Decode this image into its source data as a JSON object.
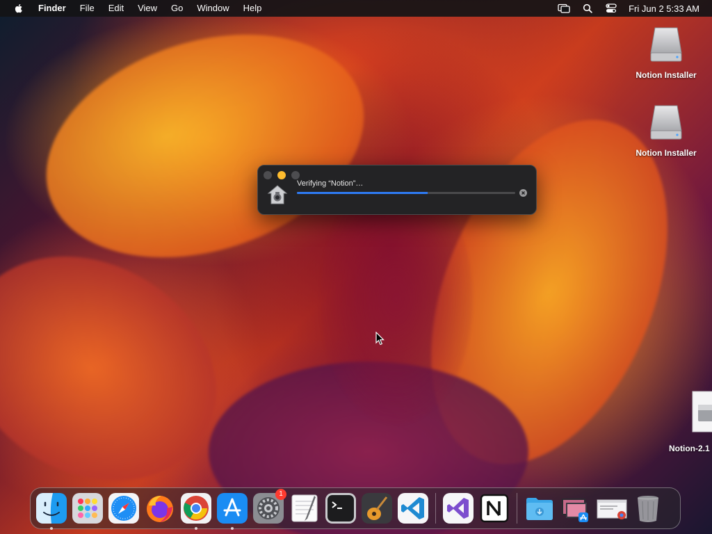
{
  "menubar": {
    "app_name": "Finder",
    "menus": [
      "File",
      "Edit",
      "View",
      "Go",
      "Window",
      "Help"
    ],
    "clock": "Fri Jun 2  5:33 AM",
    "status_icons": [
      "screen-mirroring-icon",
      "spotlight-search-icon",
      "control-center-icon"
    ]
  },
  "desktop": {
    "icons": [
      {
        "label": "Notion Installer",
        "icon": "external-drive-icon"
      },
      {
        "label": "Notion Installer",
        "icon": "external-drive-icon"
      },
      {
        "label": "Notion-2.1",
        "icon": "disk-image-file-icon"
      }
    ]
  },
  "dialog": {
    "title": "Verifying “Notion”…",
    "progress": 0.6,
    "app_icon": "finder-verification-icon",
    "progress_color": "#2e7cf6"
  },
  "dock": {
    "apps": [
      {
        "name": "Finder",
        "running": true
      },
      {
        "name": "Launchpad",
        "running": false
      },
      {
        "name": "Safari",
        "running": false
      },
      {
        "name": "Firefox",
        "running": false
      },
      {
        "name": "Google Chrome",
        "running": true
      },
      {
        "name": "App Store",
        "running": true
      },
      {
        "name": "System Preferences",
        "running": false,
        "badge": "1"
      },
      {
        "name": "TextEdit",
        "running": false
      },
      {
        "name": "Terminal",
        "running": false
      },
      {
        "name": "GarageBand",
        "running": false
      },
      {
        "name": "Visual Studio Code",
        "running": false
      },
      {
        "name": "Visual Studio",
        "running": false
      },
      {
        "name": "Notion",
        "running": false
      },
      {
        "name": "Downloads",
        "running": false
      },
      {
        "name": "Screenshot Stack",
        "running": false
      },
      {
        "name": "Chrome Window",
        "running": false
      },
      {
        "name": "Trash",
        "running": false
      }
    ]
  }
}
